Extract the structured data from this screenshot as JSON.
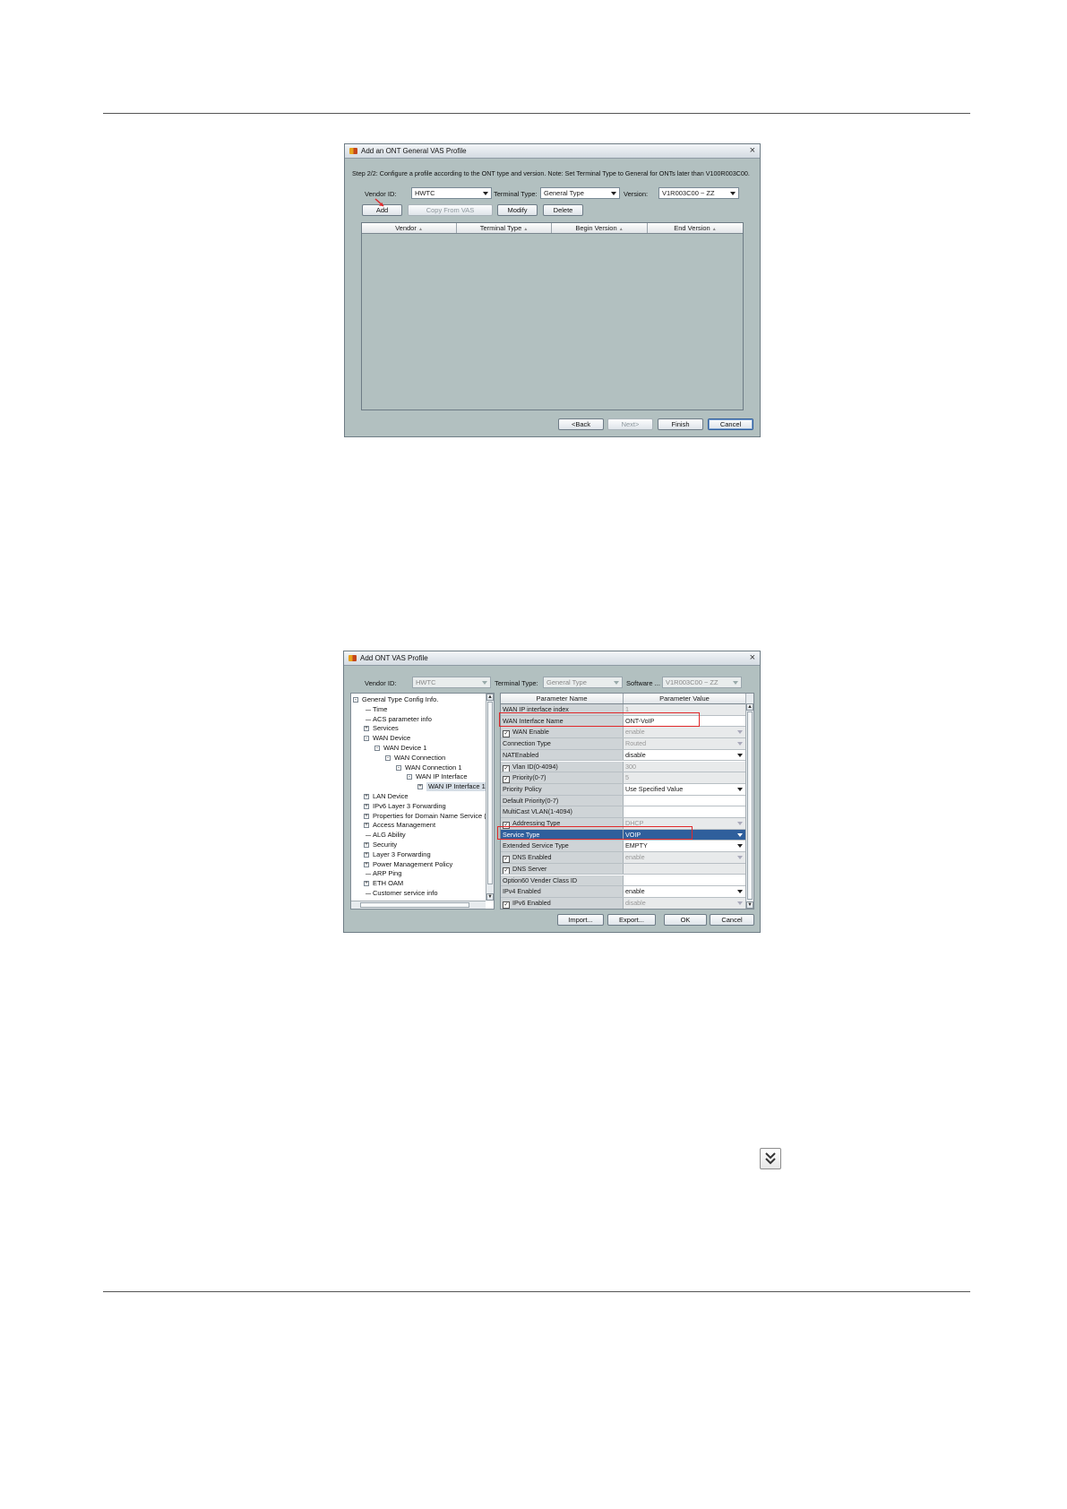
{
  "dialog1": {
    "title": "Add an ONT General VAS Profile",
    "close": "×",
    "instruction": "Step 2/2: Configure a profile according to the ONT type and version. Note: Set Terminal Type to General for ONTs later than V100R003C00.",
    "vendor_label": "Vendor ID:",
    "vendor_value": "HWTC",
    "terminal_label": "Terminal Type:",
    "terminal_value": "General Type",
    "version_label": "Version:",
    "version_value": "V1R003C00 ~ ZZ",
    "buttons": {
      "add": "Add",
      "copy": "Copy From VAS",
      "modify": "Modify",
      "delete": "Delete"
    },
    "columns": [
      "Vendor",
      "Terminal Type",
      "Begin Version",
      "End Version"
    ],
    "footer": {
      "back": "<Back",
      "next": "Next>",
      "finish": "Finish",
      "cancel": "Cancel"
    }
  },
  "dialog2": {
    "title": "Add ONT VAS Profile",
    "close": "×",
    "vendor_label": "Vendor ID:",
    "vendor_value": "HWTC",
    "terminal_label": "Terminal Type:",
    "terminal_value": "General Type",
    "software_label": "Software ...",
    "software_value": "V1R003C00 ~ ZZ",
    "tree": [
      {
        "label": "General Type Config Info.",
        "level": 0,
        "toggle": "-"
      },
      {
        "label": "Time",
        "level": 1,
        "toggle": ""
      },
      {
        "label": "ACS parameter info",
        "level": 1,
        "toggle": ""
      },
      {
        "label": "Services",
        "level": 1,
        "toggle": "+"
      },
      {
        "label": "WAN Device",
        "level": 1,
        "toggle": "-"
      },
      {
        "label": "WAN Device 1",
        "level": 2,
        "toggle": "-"
      },
      {
        "label": "WAN Connection",
        "level": 3,
        "toggle": "-"
      },
      {
        "label": "WAN Connection 1",
        "level": 4,
        "toggle": "-"
      },
      {
        "label": "WAN IP Interface",
        "level": 5,
        "toggle": "-"
      },
      {
        "label": "WAN IP Interface 1",
        "level": 6,
        "toggle": "+",
        "selected": true
      },
      {
        "label": "LAN Device",
        "level": 1,
        "toggle": "+"
      },
      {
        "label": "IPv6 Layer 3 Forwarding",
        "level": 1,
        "toggle": "+"
      },
      {
        "label": "Properties for Domain Name Service (",
        "level": 1,
        "toggle": "+"
      },
      {
        "label": "Access Management",
        "level": 1,
        "toggle": "+"
      },
      {
        "label": "ALG Ability",
        "level": 1,
        "toggle": ""
      },
      {
        "label": "Security",
        "level": 1,
        "toggle": "+"
      },
      {
        "label": "Layer 3 Forwarding",
        "level": 1,
        "toggle": "+"
      },
      {
        "label": "Power Management Policy",
        "level": 1,
        "toggle": "+"
      },
      {
        "label": "ARP Ping",
        "level": 1,
        "toggle": ""
      },
      {
        "label": "ETH OAM",
        "level": 1,
        "toggle": "+"
      },
      {
        "label": "Customer service info",
        "level": 1,
        "toggle": ""
      }
    ],
    "param_headers": [
      "Parameter Name",
      "Parameter Value"
    ],
    "params": [
      {
        "name": "WAN IP interface index",
        "value": "1",
        "check": false,
        "gray": true,
        "arrow": false
      },
      {
        "name": "WAN Interface Name",
        "value": "ONT-VoIP",
        "check": false,
        "gray": false,
        "arrow": false
      },
      {
        "name": "WAN Enable",
        "value": "enable",
        "check": true,
        "gray": true,
        "arrow": true
      },
      {
        "name": "Connection Type",
        "value": "Routed",
        "check": false,
        "gray": true,
        "arrow": true
      },
      {
        "name": "NATEnabled",
        "value": "disable",
        "check": false,
        "gray": false,
        "arrow": true
      },
      {
        "name": "Vlan ID(0-4094)",
        "value": "300",
        "check": true,
        "gray": true,
        "arrow": false
      },
      {
        "name": "Priority(0-7)",
        "value": "5",
        "check": true,
        "gray": true,
        "arrow": false
      },
      {
        "name": "Priority Policy",
        "value": "Use Specified Value",
        "check": false,
        "gray": false,
        "arrow": true
      },
      {
        "name": "Default Priority(0-7)",
        "value": "",
        "check": false,
        "gray": false,
        "arrow": false
      },
      {
        "name": "MultiCast VLAN(1-4094)",
        "value": "",
        "check": false,
        "gray": false,
        "arrow": false
      },
      {
        "name": "Addressing Type",
        "value": "DHCP",
        "check": true,
        "gray": true,
        "arrow": true
      },
      {
        "name": "Service Type",
        "value": "VOIP",
        "check": false,
        "gray": false,
        "arrow": true,
        "selected": true
      },
      {
        "name": "Extended Service Type",
        "value": "EMPTY",
        "check": false,
        "gray": false,
        "arrow": true
      },
      {
        "name": "DNS Enabled",
        "value": "enable",
        "check": true,
        "gray": true,
        "arrow": true
      },
      {
        "name": "DNS Server",
        "value": "",
        "check": true,
        "gray": true,
        "arrow": false
      },
      {
        "name": "Option60 Vender Class ID",
        "value": "",
        "check": false,
        "gray": false,
        "arrow": false
      },
      {
        "name": "IPv4 Enabled",
        "value": "enable",
        "check": false,
        "gray": false,
        "arrow": true
      },
      {
        "name": "IPv6 Enabled",
        "value": "disable",
        "check": true,
        "gray": true,
        "arrow": true
      }
    ],
    "footer": {
      "import": "Import...",
      "export": "Export...",
      "ok": "OK",
      "cancel": "Cancel"
    }
  },
  "icons": {
    "expand": "double-chevron-down-icon"
  }
}
